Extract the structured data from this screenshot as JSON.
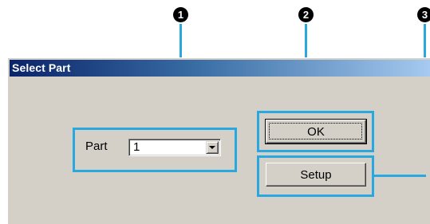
{
  "dialog": {
    "title": "Select Part",
    "part_label": "Part",
    "part_value": "1",
    "ok_label": "OK",
    "setup_label": "Setup"
  },
  "callouts": [
    "1",
    "2",
    "3"
  ],
  "colors": {
    "title_gradient_start": "#0a246a",
    "title_gradient_end": "#a6caf0",
    "dialog_face": "#d4d0c8",
    "callout_highlight": "#29a8e0",
    "badge": "#000000"
  }
}
